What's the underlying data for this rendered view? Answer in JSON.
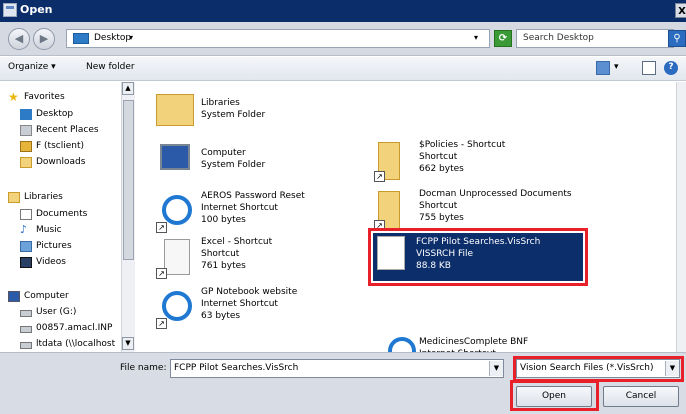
{
  "window": {
    "title": "Open",
    "close_glyph": "X"
  },
  "address_bar": {
    "back_glyph": "◀",
    "forward_glyph": "▶",
    "location": "Desktop",
    "breadcrumb_arrow": "▾",
    "dropdown_glyph": "▾",
    "refresh_glyph": "⟳",
    "search_placeholder": "Search Desktop",
    "search_glyph": "⚲"
  },
  "toolbar": {
    "organize_label": "Organize ▾",
    "new_folder_label": "New folder",
    "view_glyph": "▾"
  },
  "sidebar": {
    "scroll_up": "▲",
    "scroll_down": "▼",
    "groups": [
      {
        "header": "Favorites",
        "icon": "star-icon",
        "items": [
          {
            "label": "Desktop",
            "icon": "desktop-icon"
          },
          {
            "label": "Recent Places",
            "icon": "recent-places-icon"
          },
          {
            "label": "F (tsclient)",
            "icon": "network-drive-icon"
          },
          {
            "label": "Downloads",
            "icon": "downloads-icon"
          }
        ]
      },
      {
        "header": "Libraries",
        "icon": "libraries-icon",
        "items": [
          {
            "label": "Documents",
            "icon": "documents-icon"
          },
          {
            "label": "Music",
            "icon": "music-icon"
          },
          {
            "label": "Pictures",
            "icon": "pictures-icon"
          },
          {
            "label": "Videos",
            "icon": "videos-icon"
          }
        ]
      },
      {
        "header": "Computer",
        "icon": "computer-icon",
        "items": [
          {
            "label": "User (G:)",
            "icon": "drive-icon"
          },
          {
            "label": "00857.amacl.INP",
            "icon": "network-drive-icon"
          },
          {
            "label": "ltdata (\\\\localhost",
            "icon": "disconnected-drive-icon"
          }
        ]
      }
    ]
  },
  "files": [
    {
      "name": "Libraries",
      "type": "System Folder",
      "size": "",
      "icon": "libraries-folder-icon"
    },
    {
      "name": "Computer",
      "type": "System Folder",
      "size": "",
      "icon": "computer-icon"
    },
    {
      "name": "AEROS Password Reset",
      "type": "Internet Shortcut",
      "size": "100 bytes",
      "icon": "internet-shortcut-icon"
    },
    {
      "name": "Excel - Shortcut",
      "type": "Shortcut",
      "size": "761 bytes",
      "icon": "shortcut-icon"
    },
    {
      "name": "GP Notebook website",
      "type": "Internet Shortcut",
      "size": "63 bytes",
      "icon": "internet-shortcut-icon"
    },
    {
      "name": "$Policies - Shortcut",
      "type": "Shortcut",
      "size": "662 bytes",
      "icon": "folder-shortcut-icon"
    },
    {
      "name": "Docman Unprocessed Documents",
      "type": "Shortcut",
      "size": "755 bytes",
      "icon": "folder-shortcut-icon"
    },
    {
      "name": "FCPP Pilot Searches.VisSrch",
      "type": "VISSRCH File",
      "size": "88.8 KB",
      "icon": "file-icon",
      "selected": true
    },
    {
      "name": "MedicinesComplete BNF",
      "type": "Internet Shortcut",
      "size": "",
      "icon": "internet-shortcut-icon"
    }
  ],
  "shortcut_arrow_glyph": "↗",
  "footer": {
    "file_name_label": "File name:",
    "file_name_value": "FCPP Pilot Searches.VisSrch",
    "file_type_value": "Vision Search Files (*.VisSrch)",
    "dropdown_glyph": "▼",
    "open_label": "Open",
    "cancel_label": "Cancel"
  },
  "colors": {
    "titlebar": "#0b2e6b",
    "selection": "#0c2f6c",
    "highlight_annotation": "#e8202a"
  }
}
